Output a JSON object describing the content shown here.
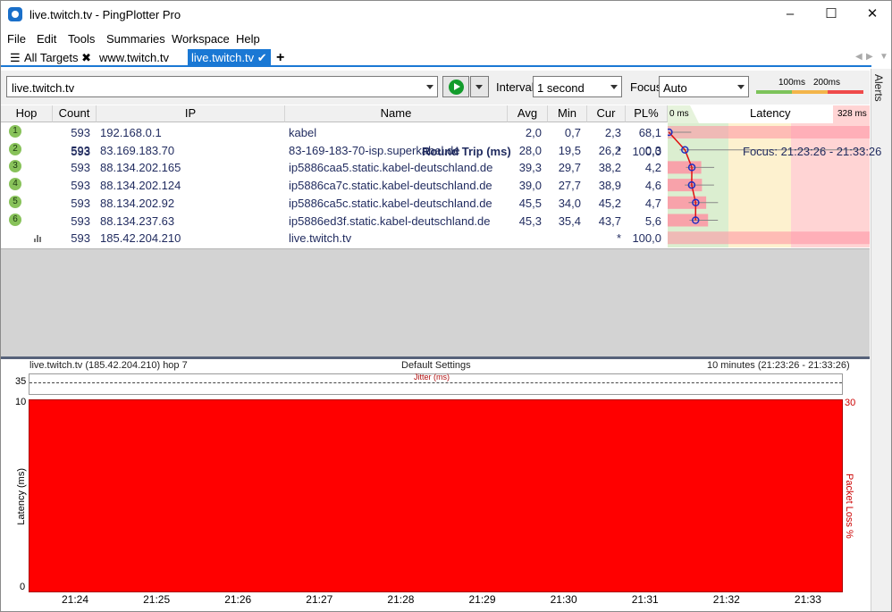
{
  "window": {
    "title": "live.twitch.tv - PingPlotter Pro"
  },
  "menu": [
    "File",
    "Edit",
    "Tools",
    "Summaries",
    "Workspace",
    "Help"
  ],
  "tabs": {
    "all_targets": "All Targets",
    "tab1": "www.twitch.tv",
    "tab2": "live.twitch.tv",
    "add": "+"
  },
  "sidebar": {
    "alerts": "Alerts"
  },
  "toolbar": {
    "target": "live.twitch.tv",
    "interval_label": "Interval",
    "interval_value": "1 second",
    "focus_label": "Focus",
    "focus_value": "Auto",
    "scale_100": "100ms",
    "scale_200": "200ms"
  },
  "colors": {
    "accent": "#1a78d4",
    "hop_dot": "#88c25a",
    "graph_red": "#ff0000",
    "pl_red": "#ffc0c0",
    "lat_green": "#d9f0d0",
    "lat_yellow": "#fdf1cf",
    "lat_red": "#ffd4d4"
  },
  "table": {
    "headers": [
      "Hop",
      "Count",
      "IP",
      "Name",
      "Avg",
      "Min",
      "Cur",
      "PL%",
      "Latency"
    ],
    "latency_min": "0 ms",
    "latency_max": "328 ms",
    "rows": [
      {
        "hop": "1",
        "count": "593",
        "ip": "192.168.0.1",
        "name": "kabel",
        "avg": "2,0",
        "min": "0,7",
        "cur": "2,3",
        "pl": "68,1"
      },
      {
        "hop": "2",
        "count": "593",
        "ip": "83.169.183.70",
        "name": "83-169-183-70-isp.superkabel.de",
        "avg": "28,0",
        "min": "19,5",
        "cur": "26,2",
        "pl": "0,3"
      },
      {
        "hop": "3",
        "count": "593",
        "ip": "88.134.202.165",
        "name": "ip5886caa5.static.kabel-deutschland.de",
        "avg": "39,3",
        "min": "29,7",
        "cur": "38,2",
        "pl": "4,2"
      },
      {
        "hop": "4",
        "count": "593",
        "ip": "88.134.202.124",
        "name": "ip5886ca7c.static.kabel-deutschland.de",
        "avg": "39,0",
        "min": "27,7",
        "cur": "38,9",
        "pl": "4,6"
      },
      {
        "hop": "5",
        "count": "593",
        "ip": "88.134.202.92",
        "name": "ip5886ca5c.static.kabel-deutschland.de",
        "avg": "45,5",
        "min": "34,0",
        "cur": "45,2",
        "pl": "4,7"
      },
      {
        "hop": "6",
        "count": "593",
        "ip": "88.134.237.63",
        "name": "ip5886ed3f.static.kabel-deutschland.de",
        "avg": "45,3",
        "min": "35,4",
        "cur": "43,7",
        "pl": "5,6"
      },
      {
        "hop": "",
        "count": "593",
        "ip": "185.42.204.210",
        "name": "live.twitch.tv",
        "avg": "",
        "min": "",
        "cur": "*",
        "pl": "100,0"
      }
    ],
    "summary": {
      "count": "593",
      "label": "Round Trip (ms)",
      "cur": "*",
      "pl": "100,0",
      "focus": "Focus: 21:23:26 - 21:33:26"
    }
  },
  "graph": {
    "target_info": "live.twitch.tv (185.42.204.210) hop 7",
    "settings": "Default Settings",
    "range": "10 minutes (21:23:26 - 21:33:26)",
    "jitter_max": "35",
    "jitter_label": "Jitter (ms)",
    "y_max": "10",
    "y_min": "0",
    "y_right_max": "30",
    "y_label": "Latency (ms)",
    "y_right_label": "Packet Loss %",
    "x_ticks": [
      "21:24",
      "21:25",
      "21:26",
      "21:27",
      "21:28",
      "21:29",
      "21:30",
      "21:31",
      "21:32",
      "21:33"
    ]
  }
}
